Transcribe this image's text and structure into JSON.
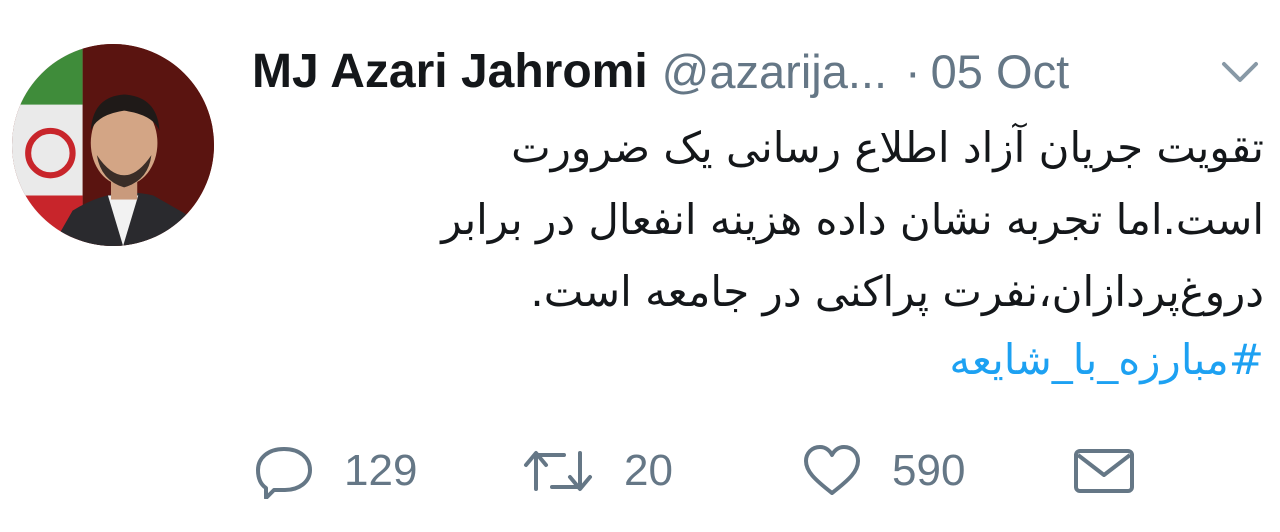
{
  "tweet": {
    "author_name": "MJ Azari Jahromi",
    "handle": "@azarija...",
    "separator": "·",
    "date": "05 Oct",
    "text_lines": [
      "تقویت جریان آزاد اطلاع رسانی یک ضرورت",
      "است.اما تجربه نشان داده هزینه انفعال در برابر",
      "دروغ‌پردازان،نفرت پراکنی در جامعه است."
    ],
    "hashtag": "#مبارزه_با_شایعه"
  },
  "actions": {
    "reply_count": "129",
    "retweet_count": "20",
    "like_count": "590"
  },
  "icons": {
    "menu": "chevron-down-icon",
    "reply": "reply-icon",
    "retweet": "retweet-icon",
    "like": "heart-icon",
    "message": "envelope-icon"
  },
  "colors": {
    "text": "#14171a",
    "secondary": "#657786",
    "link": "#1da1f2",
    "background": "#ffffff"
  }
}
